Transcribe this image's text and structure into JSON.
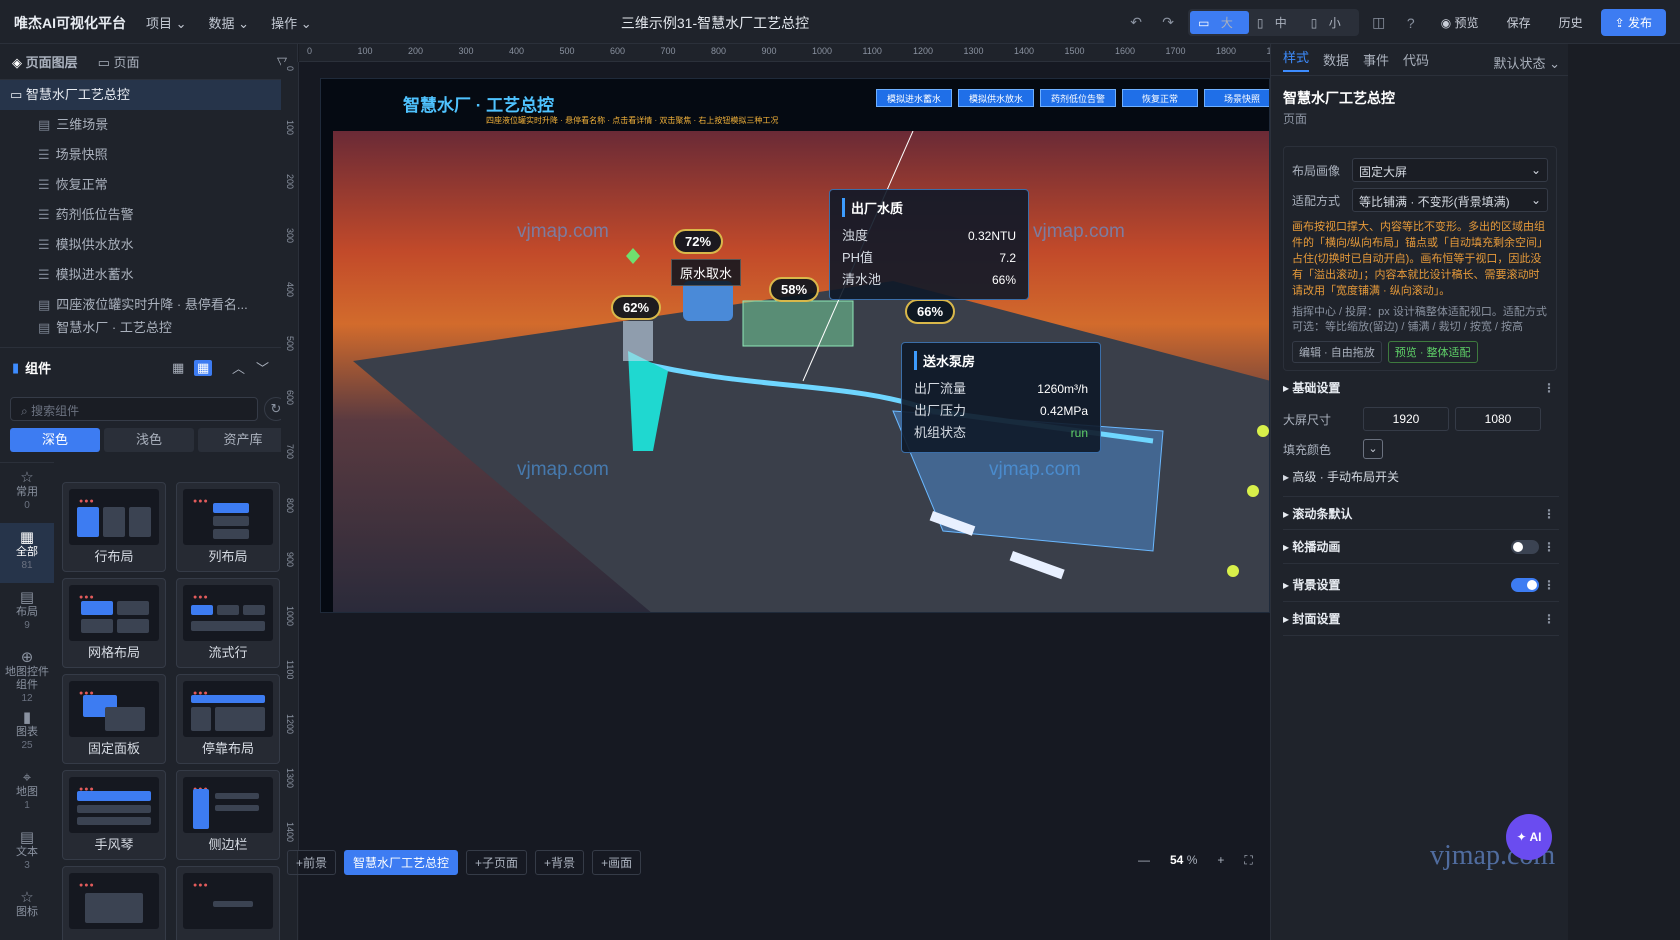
{
  "topbar": {
    "brand": "唯杰AI可视化平台",
    "menus": [
      "项目",
      "数据",
      "操作"
    ],
    "title": "三维示例31-智慧水厂工艺总控",
    "sizes": [
      "大",
      "中",
      "小"
    ],
    "preview": "预览",
    "save": "保存",
    "history": "历史",
    "publish": "发布"
  },
  "left": {
    "tab_layers": "页面图层",
    "tab_pages": "页面",
    "root": "智慧水厂工艺总控",
    "items": [
      "三维场景",
      "场景快照",
      "恢复正常",
      "药剂低位告警",
      "模拟供水放水",
      "模拟进水蓄水",
      "四座液位罐实时升降 · 悬停看名...",
      "智慧水厂 · 工艺总控"
    ],
    "comp_title": "组件",
    "search_placeholder": "搜索组件",
    "palette": [
      "深色",
      "浅色",
      "资产库"
    ],
    "cats": [
      {
        "label": "常用",
        "count": "0"
      },
      {
        "label": "全部",
        "count": "81"
      },
      {
        "label": "布局",
        "count": "9"
      },
      {
        "label": "地图控件组件",
        "count": "12"
      },
      {
        "label": "图表",
        "count": "25"
      },
      {
        "label": "地图",
        "count": "1"
      },
      {
        "label": "文本",
        "count": "3"
      },
      {
        "label": "图标",
        "count": ""
      }
    ],
    "cards": [
      "行布局",
      "列布局",
      "网格布局",
      "流式行",
      "固定面板",
      "停靠布局",
      "手风琴",
      "侧边栏",
      "",
      ""
    ]
  },
  "stage": {
    "title": "智慧水厂 · 工艺总控",
    "subtitle": "四座液位罐实时升降 · 悬停看名称 · 点击看详情 · 双击聚焦 · 右上按钮模拟三种工况",
    "buttons": [
      "模拟进水蓄水",
      "模拟供水放水",
      "药剂低位告警",
      "恢复正常",
      "场景快照"
    ],
    "panel1": {
      "title": "出厂水质",
      "rows": [
        [
          "浊度",
          "0.32NTU"
        ],
        [
          "PH值",
          "7.2"
        ],
        [
          "清水池",
          "66%"
        ]
      ]
    },
    "panel2": {
      "title": "送水泵房",
      "rows": [
        [
          "出厂流量",
          "1260m³/h"
        ],
        [
          "出厂压力",
          "0.42MPa"
        ],
        [
          "机组状态",
          "run"
        ]
      ]
    },
    "badges": [
      "72%",
      "62%",
      "58%",
      "66%"
    ],
    "tank_label": "原水取水",
    "watermarks": [
      "vjmap.com",
      "vjmap.com",
      "vjmap.com",
      "vjmap.com"
    ]
  },
  "ruler": {
    "h": [
      "0",
      "100",
      "200",
      "300",
      "400",
      "500",
      "600",
      "700",
      "800",
      "900",
      "1000",
      "1100",
      "1200",
      "1300",
      "1400",
      "1500",
      "1600",
      "1700",
      "1800",
      "19"
    ],
    "v": [
      "0",
      "100",
      "200",
      "300",
      "400",
      "500",
      "600",
      "700",
      "800",
      "900",
      "1000",
      "1100",
      "1200",
      "1300",
      "1400",
      "1500"
    ]
  },
  "bottom": {
    "pages": [
      "+前景",
      "智慧水厂工艺总控",
      "+子页面",
      "+背景",
      "+画面"
    ],
    "zoom": "54",
    "zoom_unit": "%"
  },
  "right": {
    "tabs": [
      "样式",
      "数据",
      "事件",
      "代码"
    ],
    "state": "默认状态",
    "title": "智慧水厂工艺总控",
    "sub": "页面",
    "layout_label": "布局画像",
    "layout_value": "固定大屏",
    "fit_label": "适配方式",
    "fit_value": "等比铺满 · 不变形(背景填满)",
    "warn": "画布按视口撑大、内容等比不变形。多出的区域由组件的「横向/纵向布局」锚点或「自动填充剩余空间」占住(切换时已自动开启)。画布恒等于视口，因此没有「溢出滚动」；内容本就比设计稿长、需要滚动时请改用「宽度铺满 · 纵向滚动」。",
    "hint": "指挥中心 / 投屏：px 设计稿整体适配视口。适配方式可选：等比缩放(留边) / 铺满 / 裁切 / 按宽 / 按高",
    "tags": [
      "编辑 · 自由拖放",
      "预览 · 整体适配"
    ],
    "basic": "基础设置",
    "size_label": "大屏尺寸",
    "w": "1920",
    "h": "1080",
    "fill_label": "填充颜色",
    "adv": "高级 · 手动布局开关",
    "sections": [
      "滚动条默认",
      "轮播动画",
      "背景设置",
      "封面设置"
    ],
    "ai": "AI",
    "wm": "vjmap.com"
  }
}
